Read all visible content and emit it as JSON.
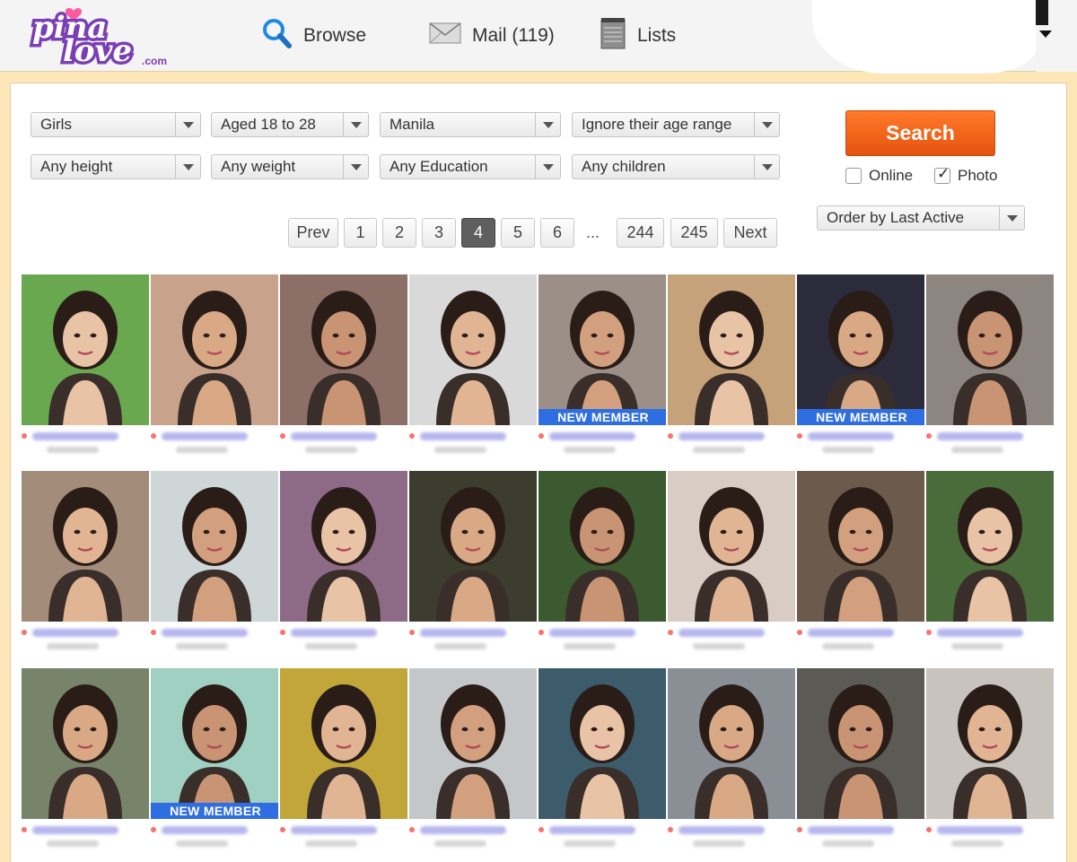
{
  "header": {
    "logo_text": "pina love .com",
    "nav": [
      {
        "label": "Browse",
        "icon": "search-icon"
      },
      {
        "label": "Mail (119)",
        "icon": "envelope-icon"
      },
      {
        "label": "Lists",
        "icon": "notepad-icon"
      }
    ]
  },
  "filters": {
    "row1": [
      "Girls",
      "Aged 18 to 28",
      "Manila",
      "Ignore their age range"
    ],
    "row2": [
      "Any height",
      "Any weight",
      "Any Education",
      "Any children"
    ],
    "search_label": "Search",
    "online_label": "Online",
    "online_checked": false,
    "photo_label": "Photo",
    "photo_checked": true,
    "order_label": "Order by Last Active"
  },
  "pagination": {
    "prev": "Prev",
    "pages": [
      "1",
      "2",
      "3",
      "4",
      "5",
      "6"
    ],
    "current": "4",
    "ellipsis": "...",
    "last_pages": [
      "244",
      "245"
    ],
    "next": "Next"
  },
  "colors": {
    "accent": "#f0641c",
    "badge": "#2f6ee0",
    "background": "#fde7b9",
    "logo": "#7b3fb5"
  },
  "profiles": [
    {
      "badge": ""
    },
    {
      "badge": ""
    },
    {
      "badge": ""
    },
    {
      "badge": ""
    },
    {
      "badge": "NEW MEMBER"
    },
    {
      "badge": ""
    },
    {
      "badge": "NEW MEMBER"
    },
    {
      "badge": ""
    },
    {
      "badge": ""
    },
    {
      "badge": ""
    },
    {
      "badge": ""
    },
    {
      "badge": ""
    },
    {
      "badge": ""
    },
    {
      "badge": ""
    },
    {
      "badge": ""
    },
    {
      "badge": ""
    },
    {
      "badge": ""
    },
    {
      "badge": "NEW MEMBER"
    },
    {
      "badge": ""
    },
    {
      "badge": ""
    },
    {
      "badge": ""
    },
    {
      "badge": ""
    },
    {
      "badge": ""
    },
    {
      "badge": ""
    }
  ]
}
